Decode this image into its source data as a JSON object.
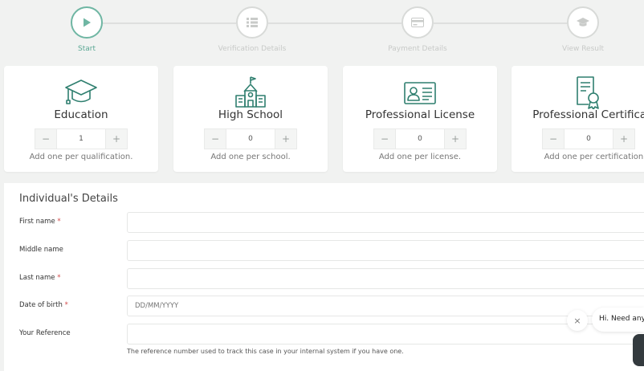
{
  "stepper": {
    "steps": [
      {
        "label": "Start",
        "icon": "play-icon",
        "active": true
      },
      {
        "label": "Verification Details",
        "icon": "list-icon",
        "active": false
      },
      {
        "label": "Payment Details",
        "icon": "credit-card-icon",
        "active": false
      },
      {
        "label": "View Result",
        "icon": "graduation-cap-icon",
        "active": false
      }
    ]
  },
  "cards": [
    {
      "title": "Education",
      "value": "1",
      "hint": "Add one per qualification.",
      "icon": "graduation-cap-icon"
    },
    {
      "title": "High School",
      "value": "0",
      "hint": "Add one per school.",
      "icon": "school-building-icon"
    },
    {
      "title": "Professional License",
      "value": "0",
      "hint": "Add one per license.",
      "icon": "id-card-icon"
    },
    {
      "title": "Professional Certificate",
      "value": "0",
      "hint": "Add one per certification.",
      "icon": "certificate-icon"
    }
  ],
  "stepper_controls": {
    "minus": "−",
    "plus": "+"
  },
  "form": {
    "title": "Individual's Details",
    "fields": [
      {
        "label": "First name",
        "required": true,
        "placeholder": "",
        "value": ""
      },
      {
        "label": "Middle name",
        "required": false,
        "placeholder": "",
        "value": ""
      },
      {
        "label": "Last name",
        "required": true,
        "placeholder": "",
        "value": ""
      },
      {
        "label": "Date of birth",
        "required": true,
        "placeholder": "DD/MM/YYYY",
        "value": ""
      },
      {
        "label": "Your Reference",
        "required": false,
        "placeholder": "",
        "value": ""
      }
    ],
    "required_mark": "*",
    "reference_help": "The reference number used to track this case in your internal system if you have one."
  },
  "chat": {
    "close_glyph": "×",
    "greeting": "Hi. Need any h"
  },
  "colors": {
    "accent": "#6fb6a3",
    "accent_text": "#5aa793",
    "required": "#d24b4b",
    "background": "#f1f2f1"
  }
}
